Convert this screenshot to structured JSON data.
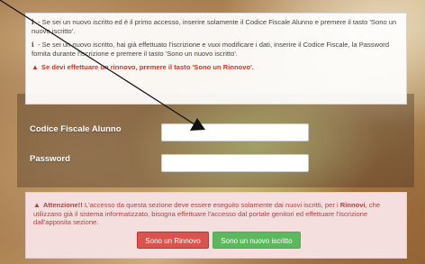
{
  "info": {
    "line1_prefix": "ℹ",
    "line1": "- Se sei un nuovo iscritto ed è il primo accesso, inserire solamente il Codice Fiscale Alunno e premere il tasto 'Sono un nuovo iscritto'.",
    "line2_prefix": "ℹ",
    "line2": "- Se sei un nuovo iscritto, hai già effettuato l'iscrizione e vuoi modificare i dati, inserire il Codice Fiscale, la Password fornita durante l'iscrizione e premere il tasto 'Sono un nuovo iscritto'.",
    "warn": "Se devi effettuare un rinnovo, premere il tasto 'Sono un Rinnovo'."
  },
  "form": {
    "codice_label": "Codice Fiscale Alunno",
    "codice_value": "",
    "password_label": "Password",
    "password_value": ""
  },
  "alert": {
    "title": "Attenzione!!",
    "text_a": " L'accesso da questa sezione deve essere eseguito solamente dai nuovi iscritti, per i ",
    "bold": "Rinnovi",
    "text_b": ", che utilizzano già il sistema informatizzato, bisogna effettuare l'accesso dal portale genitori ed effettuare l'iscrizione dall'apposita sezione."
  },
  "buttons": {
    "renew": "Sono un Rinnovo",
    "new": "Sono un nuovo iscritto"
  },
  "colors": {
    "renew_bg": "#d9534f",
    "new_bg": "#5cb85c",
    "alert_text": "#a94442"
  }
}
